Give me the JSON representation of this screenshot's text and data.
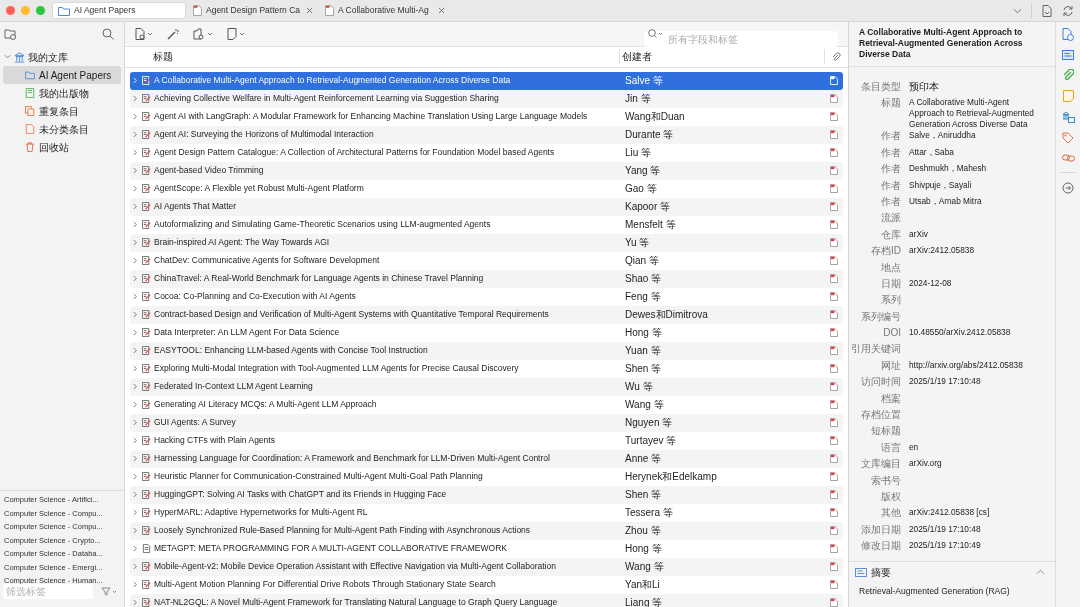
{
  "tabs": [
    {
      "label": "AI Agent Papers",
      "kind": "library",
      "selected": true
    },
    {
      "label": "Agent Design Pattern Ca",
      "kind": "pdf",
      "selected": false
    },
    {
      "label": "A Collaborative Multi-Ag",
      "kind": "pdf",
      "selected": false
    }
  ],
  "sidebar": {
    "library": {
      "label": "我的文库",
      "expanded": true,
      "items": [
        {
          "label": "AI Agent Papers",
          "kind": "collection",
          "selected": true
        },
        {
          "label": "我的出版物",
          "kind": "publications",
          "selected": false
        },
        {
          "label": "重复条目",
          "kind": "duplicates",
          "selected": false
        },
        {
          "label": "未分类条目",
          "kind": "unfiled",
          "selected": false
        },
        {
          "label": "回收站",
          "kind": "trash",
          "selected": false
        }
      ]
    },
    "tags": [
      "Computer Science - Artifici...",
      "Computer Science - Compu...",
      "Computer Science - Compu...",
      "Computer Science - Crypto...",
      "Computer Science - Databa...",
      "Computer Science - Emergi...",
      "Computer Science - Human..."
    ],
    "tag_filter": {
      "placeholder": "筛选标签"
    }
  },
  "search": {
    "placeholder": "所有字段和标签"
  },
  "table": {
    "columns": [
      "标题",
      "创建者"
    ],
    "rows": [
      {
        "title": "A Collaborative Multi-Agent Approach to Retrieval-Augmented Generation Across Diverse Data",
        "creator": "Salve 等",
        "kind": "preprint",
        "selected": true
      },
      {
        "title": "Achieving Collective Welfare in Multi-Agent Reinforcement Learning via Suggestion Sharing",
        "creator": "Jin 等",
        "kind": "preprint",
        "selected": false
      },
      {
        "title": "Agent AI with LangGraph: A Modular Framework for Enhancing Machine Translation Using Large Language Models",
        "creator": "Wang和Duan",
        "kind": "preprint",
        "selected": false
      },
      {
        "title": "Agent AI: Surveying the Horizons of Multimodal Interaction",
        "creator": "Durante 等",
        "kind": "preprint",
        "selected": false
      },
      {
        "title": "Agent Design Pattern Catalogue: A Collection of Architectural Patterns for Foundation Model based Agents",
        "creator": "Liu 等",
        "kind": "preprint",
        "selected": false
      },
      {
        "title": "Agent-based Video Trimming",
        "creator": "Yang 等",
        "kind": "preprint",
        "selected": false
      },
      {
        "title": "AgentScope: A Flexible yet Robust Multi-Agent Platform",
        "creator": "Gao 等",
        "kind": "preprint",
        "selected": false
      },
      {
        "title": "AI Agents That Matter",
        "creator": "Kapoor 等",
        "kind": "preprint",
        "selected": false
      },
      {
        "title": "Autoformalizing and Simulating Game-Theoretic Scenarios using LLM-augmented Agents",
        "creator": "Mensfelt 等",
        "kind": "preprint",
        "selected": false
      },
      {
        "title": "Brain-inspired AI Agent: The Way Towards AGI",
        "creator": "Yu 等",
        "kind": "preprint",
        "selected": false
      },
      {
        "title": "ChatDev: Communicative Agents for Software Development",
        "creator": "Qian 等",
        "kind": "preprint",
        "selected": false
      },
      {
        "title": "ChinaTravel: A Real-World Benchmark for Language Agents in Chinese Travel Planning",
        "creator": "Shao 等",
        "kind": "preprint",
        "selected": false
      },
      {
        "title": "Cocoa: Co-Planning and Co-Execution with AI Agents",
        "creator": "Feng 等",
        "kind": "preprint",
        "selected": false
      },
      {
        "title": "Contract-based Design and Verification of Multi-Agent Systems with Quantitative Temporal Requirements",
        "creator": "Dewes和Dimitrova",
        "kind": "preprint",
        "selected": false
      },
      {
        "title": "Data Interpreter: An LLM Agent For Data Science",
        "creator": "Hong 等",
        "kind": "preprint",
        "selected": false
      },
      {
        "title": "EASYTOOL: Enhancing LLM-based Agents with Concise Tool Instruction",
        "creator": "Yuan 等",
        "kind": "preprint",
        "selected": false
      },
      {
        "title": "Exploring Multi-Modal Integration with Tool-Augmented LLM Agents for Precise Causal Discovery",
        "creator": "Shen 等",
        "kind": "preprint",
        "selected": false
      },
      {
        "title": "Federated In-Context LLM Agent Learning",
        "creator": "Wu 等",
        "kind": "preprint",
        "selected": false
      },
      {
        "title": "Generating AI Literacy MCQs: A Multi-Agent LLM Approach",
        "creator": "Wang 等",
        "kind": "preprint",
        "selected": false
      },
      {
        "title": "GUI Agents: A Survey",
        "creator": "Nguyen 等",
        "kind": "preprint",
        "selected": false
      },
      {
        "title": "Hacking CTFs with Plain Agents",
        "creator": "Turtayev 等",
        "kind": "preprint",
        "selected": false
      },
      {
        "title": "Harnessing Language for Coordination: A Framework and Benchmark for LLM-Driven Multi-Agent Control",
        "creator": "Anne 等",
        "kind": "preprint",
        "selected": false
      },
      {
        "title": "Heuristic Planner for Communication-Constrained Multi-Agent Multi-Goal Path Planning",
        "creator": "Herynek和Edelkamp",
        "kind": "preprint",
        "selected": false
      },
      {
        "title": "HuggingGPT: Solving AI Tasks with ChatGPT and its Friends in Hugging Face",
        "creator": "Shen 等",
        "kind": "preprint",
        "selected": false
      },
      {
        "title": "HyperMARL: Adaptive Hypernetworks for Multi-Agent RL",
        "creator": "Tessera 等",
        "kind": "preprint",
        "selected": false
      },
      {
        "title": "Loosely Synchronized Rule-Based Planning for Multi-Agent Path Finding with Asynchronous Actions",
        "creator": "Zhou 等",
        "kind": "preprint",
        "selected": false
      },
      {
        "title": "METAGPT: META PROGRAMMING FOR A MULTI-AGENT COLLABORATIVE FRAMEWORK",
        "creator": "Hong 等",
        "kind": "document",
        "selected": false
      },
      {
        "title": "Mobile-Agent-v2: Mobile Device Operation Assistant with Effective Navigation via Multi-Agent Collaboration",
        "creator": "Wang 等",
        "kind": "preprint",
        "selected": false
      },
      {
        "title": "Multi-Agent Motion Planning For Differential Drive Robots Through Stationary State Search",
        "creator": "Yan和Li",
        "kind": "preprint",
        "selected": false
      },
      {
        "title": "NAT-NL2GQL: A Novel Multi-Agent Framework for Translating Natural Language to Graph Query Language",
        "creator": "Liang 等",
        "kind": "preprint",
        "selected": false
      }
    ]
  },
  "item_pane": {
    "title": "A Collaborative Multi-Agent Approach to Retrieval-Augmented Generation Across Diverse Data",
    "fields": [
      {
        "label": "条目类型",
        "value": "预印本"
      },
      {
        "label": "标题",
        "value": "A Collaborative Multi-Agent Approach to Retrieval-Augmented Generation Across Diverse Data"
      },
      {
        "label": "作者",
        "value": "Salve，Aniruddha"
      },
      {
        "label": "作者",
        "value": "Attar，Saba"
      },
      {
        "label": "作者",
        "value": "Deshmukh，Mahesh"
      },
      {
        "label": "作者",
        "value": "Shivpuje，Sayali"
      },
      {
        "label": "作者",
        "value": "Utsab，Arnab Mitra"
      },
      {
        "label": "流派"
      },
      {
        "label": "仓库",
        "value": "arXiv"
      },
      {
        "label": "存档ID",
        "value": "arXiv:2412.05838"
      },
      {
        "label": "地点"
      },
      {
        "label": "日期",
        "value": "2024-12-08"
      },
      {
        "label": "系列"
      },
      {
        "label": "系列编号"
      },
      {
        "label": "DOI",
        "value": "10.48550/arXiv.2412.05838"
      },
      {
        "label": "引用关键词"
      },
      {
        "label": "网址",
        "value": "http://arxiv.org/abs/2412.05838"
      },
      {
        "label": "访问时间",
        "value": "2025/1/19 17:10:48"
      },
      {
        "label": "档案"
      },
      {
        "label": "存档位置"
      },
      {
        "label": "短标题"
      },
      {
        "label": "语言",
        "value": "en"
      },
      {
        "label": "文库编目",
        "value": "arXiv.org"
      },
      {
        "label": "索书号"
      },
      {
        "label": "版权"
      },
      {
        "label": "其他",
        "value": "arXiv:2412.05838 [cs]"
      },
      {
        "label": "添加日期",
        "value": "2025/1/19 17:10:48"
      },
      {
        "label": "修改日期",
        "value": "2025/1/19 17:10:49"
      }
    ],
    "abstract": {
      "heading": "摘要",
      "text": "Retrieval-Augmented Generation (RAG)",
      "expanded": true
    }
  }
}
